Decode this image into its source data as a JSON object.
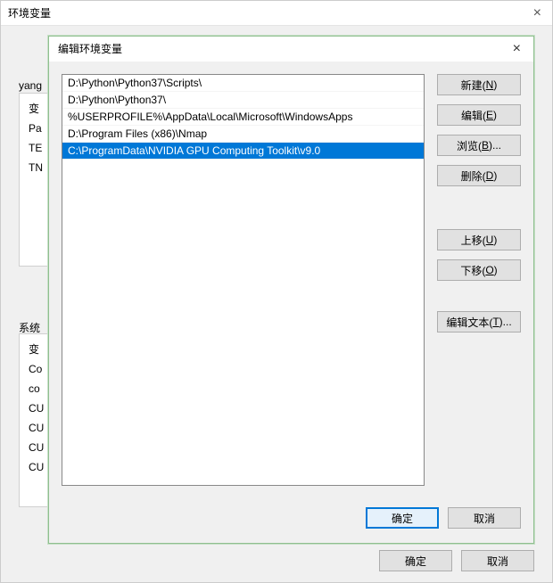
{
  "outer": {
    "title": "环境变量",
    "close": "×",
    "group1_label": "yang",
    "group2_label": "系统",
    "list1": "变\nPa\nTE\nTN",
    "list2": "变\nCo\nco\nCU\nCU\nCU\nCU",
    "ok": "确定",
    "cancel": "取消"
  },
  "inner": {
    "title": "编辑环境变量",
    "close": "×",
    "paths": [
      "D:\\Python\\Python37\\Scripts\\",
      "D:\\Python\\Python37\\",
      "%USERPROFILE%\\AppData\\Local\\Microsoft\\WindowsApps",
      "D:\\Program Files (x86)\\Nmap",
      "C:\\ProgramData\\NVIDIA GPU Computing Toolkit\\v9.0"
    ],
    "selected_index": 4,
    "buttons": {
      "new": {
        "label": "新建(",
        "m": "N",
        "tail": ")"
      },
      "edit": {
        "label": "编辑(",
        "m": "E",
        "tail": ")"
      },
      "browse": {
        "label": "浏览(",
        "m": "B",
        "tail": ")..."
      },
      "delete": {
        "label": "删除(",
        "m": "D",
        "tail": ")"
      },
      "up": {
        "label": "上移(",
        "m": "U",
        "tail": ")"
      },
      "down": {
        "label": "下移(",
        "m": "O",
        "tail": ")"
      },
      "edit_text": {
        "label": "编辑文本(",
        "m": "T",
        "tail": ")..."
      }
    },
    "ok": "确定",
    "cancel": "取消"
  }
}
